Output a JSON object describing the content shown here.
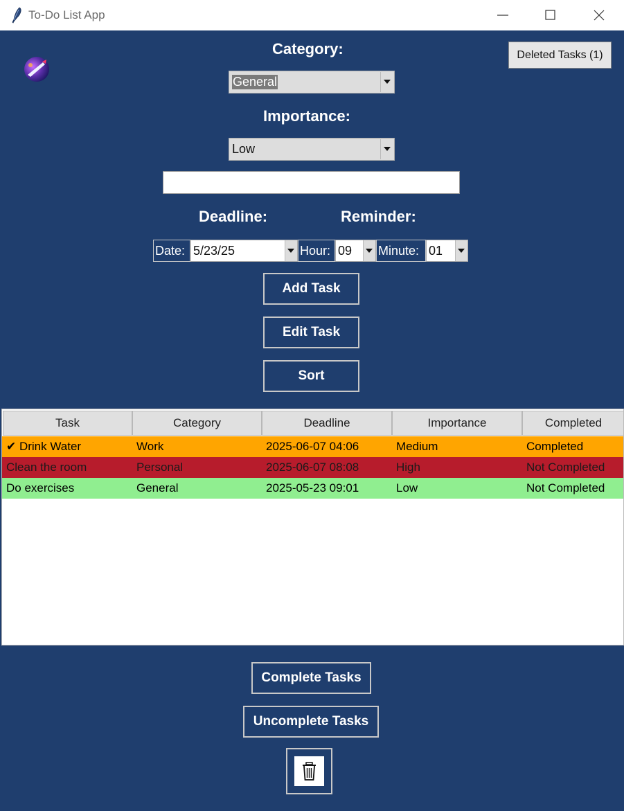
{
  "window": {
    "title": "To-Do List App"
  },
  "form": {
    "category_label": "Category:",
    "category_value": "General",
    "importance_label": "Importance:",
    "importance_value": "Low",
    "task_input_value": "",
    "deadline_label": "Deadline:",
    "reminder_label": "Reminder:",
    "date_label": "Date:",
    "date_value": "5/23/25",
    "hour_label": "Hour:",
    "hour_value": "09",
    "minute_label": "Minute:",
    "minute_value": "01"
  },
  "buttons": {
    "deleted_tasks": "Deleted Tasks (1)",
    "add_task": "Add Task",
    "edit_task": "Edit Task",
    "sort": "Sort",
    "complete_tasks": "Complete Tasks",
    "uncomplete_tasks": "Uncomplete Tasks"
  },
  "table": {
    "columns": [
      "Task",
      "Category",
      "Deadline",
      "Importance",
      "Completed"
    ],
    "rows": [
      {
        "task": "✔ Drink Water",
        "category": "Work",
        "deadline": "2025-06-07 04:06",
        "importance": "Medium",
        "completed": "Completed",
        "bg": "#ffa500",
        "fg": "#000000"
      },
      {
        "task": "Clean the room",
        "category": "Personal",
        "deadline": "2025-06-07 08:08",
        "importance": "High",
        "completed": "Not Completed",
        "bg": "#b71c2c",
        "fg": "#1a1a1a"
      },
      {
        "task": "Do exercises",
        "category": "General",
        "deadline": "2025-05-23 09:01",
        "importance": "Low",
        "completed": "Not Completed",
        "bg": "#90ee90",
        "fg": "#000000"
      }
    ]
  },
  "icons": {
    "app": "feather-icon",
    "logo": "app-logo-icon",
    "trash": "trash-icon"
  },
  "colors": {
    "background": "#1f3e6e",
    "row_completed": "#ffa500",
    "row_high": "#b71c2c",
    "row_low": "#90ee90"
  }
}
